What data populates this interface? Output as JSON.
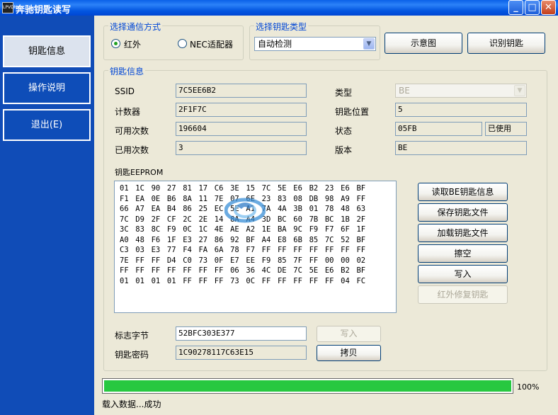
{
  "window": {
    "icon_text": "LPVDN",
    "title": "奔驰钥匙读写"
  },
  "sidebar": {
    "items": [
      {
        "label": "钥匙信息",
        "active": true
      },
      {
        "label": "操作说明",
        "active": false
      },
      {
        "label": "退出(E)",
        "active": false
      }
    ]
  },
  "comm": {
    "title": "选择通信方式",
    "options": [
      "红外",
      "NEC适配器"
    ],
    "selected": "红外"
  },
  "keytype": {
    "title": "选择钥匙类型",
    "selected": "自动检测"
  },
  "top_buttons": {
    "diagram": "示意图",
    "identify": "识别钥匙"
  },
  "keyinfo": {
    "title": "钥匙信息",
    "ssid_label": "SSID",
    "ssid": "7C5EE6B2",
    "counter_label": "计数器",
    "counter": "2F1F7C",
    "avail_label": "可用次数",
    "avail": "196604",
    "used_label": "已用次数",
    "used": "3",
    "type_label": "类型",
    "type": "BE",
    "pos_label": "钥匙位置",
    "pos": "5",
    "state_label": "状态",
    "state": "05FB",
    "state_text": "已使用",
    "version_label": "版本",
    "version": "BE"
  },
  "eeprom": {
    "label": "钥匙EEPROM",
    "rows": [
      [
        "01",
        "1C",
        "90",
        "27",
        "81",
        "17",
        "C6",
        "3E",
        "15",
        "7C",
        "5E",
        "E6",
        "B2",
        "23",
        "E6",
        "BF"
      ],
      [
        "F1",
        "EA",
        "0E",
        "B6",
        "8A",
        "11",
        "7E",
        "07",
        "6E",
        "23",
        "83",
        "08",
        "DB",
        "98",
        "A9",
        "FF"
      ],
      [
        "66",
        "A7",
        "EA",
        "B4",
        "86",
        "25",
        "EC",
        "5E",
        "A1",
        "7A",
        "4A",
        "3B",
        "01",
        "78",
        "48",
        "63"
      ],
      [
        "7C",
        "D9",
        "2F",
        "CF",
        "2C",
        "2E",
        "14",
        "8A",
        "A4",
        "3D",
        "BC",
        "60",
        "7B",
        "BC",
        "1B",
        "2F"
      ],
      [
        "3C",
        "83",
        "8C",
        "F9",
        "0C",
        "1C",
        "4E",
        "AE",
        "A2",
        "1E",
        "BA",
        "9C",
        "F9",
        "F7",
        "6F",
        "1F"
      ],
      [
        "A0",
        "48",
        "F6",
        "1F",
        "E3",
        "27",
        "86",
        "92",
        "BF",
        "A4",
        "E8",
        "6B",
        "85",
        "7C",
        "52",
        "BF"
      ],
      [
        "C3",
        "03",
        "E3",
        "77",
        "F4",
        "FA",
        "6A",
        "78",
        "F7",
        "FF",
        "FF",
        "FF",
        "FF",
        "FF",
        "FF",
        "FF"
      ],
      [
        "7E",
        "FF",
        "FF",
        "D4",
        "C0",
        "73",
        "0F",
        "E7",
        "EE",
        "F9",
        "85",
        "7F",
        "FF",
        "00",
        "00",
        "02"
      ],
      [
        "FF",
        "FF",
        "FF",
        "FF",
        "FF",
        "FF",
        "FF",
        "06",
        "36",
        "4C",
        "DE",
        "7C",
        "5E",
        "E6",
        "B2",
        "BF"
      ],
      [
        "01",
        "01",
        "01",
        "01",
        "FF",
        "FF",
        "FF",
        "73",
        "0C",
        "FF",
        "FF",
        "FF",
        "FF",
        "FF",
        "04",
        "FC"
      ]
    ]
  },
  "actions": {
    "read_be": "读取BE钥匙信息",
    "save_file": "保存钥匙文件",
    "load_file": "加载钥匙文件",
    "erase": "擦空",
    "write": "写入",
    "ir_repair": "红外修复钥匙"
  },
  "flag": {
    "label": "标志字节",
    "value": "52BFC303E377",
    "write_button": "写入"
  },
  "password": {
    "label": "钥匙密码",
    "value": "1C90278117C63E15",
    "copy_button": "拷贝"
  },
  "progress": {
    "percent_value": 100,
    "percent_text": "100%"
  },
  "status": {
    "text": "载入数据...成功"
  },
  "colors": {
    "sidebar": "#104CB7",
    "accent_text": "#0046D5",
    "progress": "#27C840"
  }
}
